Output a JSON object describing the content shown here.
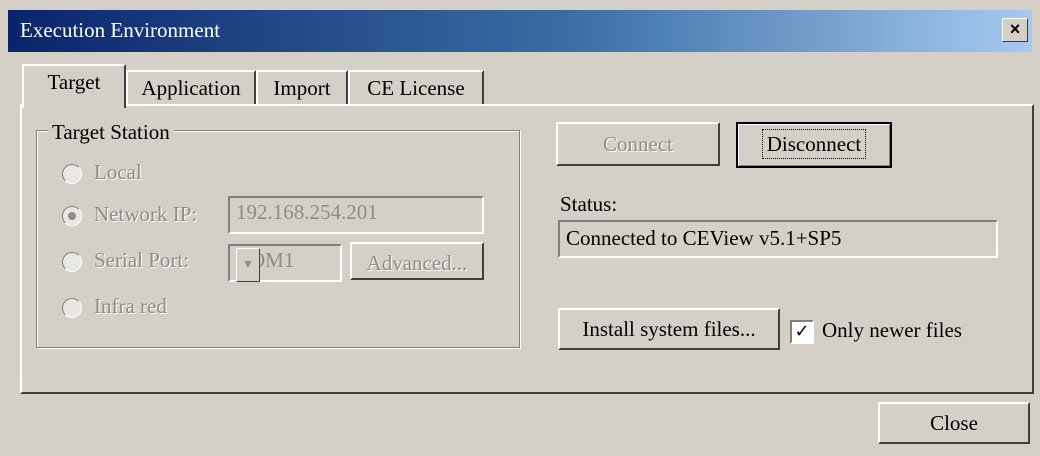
{
  "window": {
    "title": "Execution Environment",
    "close_glyph": "×"
  },
  "tabs": [
    {
      "label": "Target",
      "active": true
    },
    {
      "label": "Application",
      "active": false
    },
    {
      "label": "Import",
      "active": false
    },
    {
      "label": "CE License",
      "active": false
    }
  ],
  "target_station": {
    "title": "Target Station",
    "options": [
      {
        "label": "Local",
        "selected": false
      },
      {
        "label": "Network IP:",
        "selected": true
      },
      {
        "label": "Serial Port:",
        "selected": false
      },
      {
        "label": "Infra red",
        "selected": false
      }
    ],
    "network_ip_value": "192.168.254.201",
    "serial_port_value": "COM1",
    "advanced_label": "Advanced..."
  },
  "connection": {
    "connect_label": "Connect",
    "disconnect_label": "Disconnect",
    "status_label": "Status:",
    "status_value": "Connected to CEView v5.1+SP5"
  },
  "install": {
    "install_label": "Install system files...",
    "only_newer_label": "Only newer files",
    "only_newer_checked": true
  },
  "footer": {
    "close_label": "Close"
  }
}
